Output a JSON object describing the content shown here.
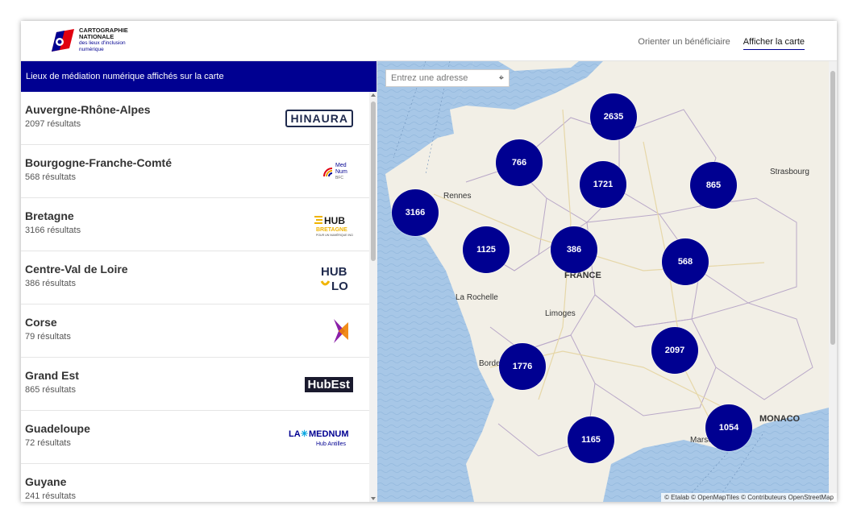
{
  "brand": {
    "line1": "CARTOGRAPHIE",
    "line2": "NATIONALE",
    "line3": "des lieux d'inclusion",
    "line4": "numérique"
  },
  "nav": {
    "orienter": "Orienter un bénéficiaire",
    "afficher": "Afficher la carte"
  },
  "sidebar": {
    "title": "Lieux de médiation numérique affichés sur la carte",
    "items": [
      {
        "name": "Auvergne-Rhône-Alpes",
        "count": "2097 résultats",
        "logo": "HINAURA"
      },
      {
        "name": "Bourgogne-Franche-Comté",
        "count": "568 résultats",
        "logo": "MedNum BFC"
      },
      {
        "name": "Bretagne",
        "count": "3166 résultats",
        "logo": "HUB BRETAGNE"
      },
      {
        "name": "Centre-Val de Loire",
        "count": "386 résultats",
        "logo": "HUB LO"
      },
      {
        "name": "Corse",
        "count": "79 résultats",
        "logo": "Corse"
      },
      {
        "name": "Grand Est",
        "count": "865 résultats",
        "logo": "HubEst"
      },
      {
        "name": "Guadeloupe",
        "count": "72 résultats",
        "logo": "LA MEDNUM Hub Antilles"
      },
      {
        "name": "Guyane",
        "count": "241 résultats",
        "logo": ""
      }
    ]
  },
  "map": {
    "search_placeholder": "Entrez une adresse",
    "clusters": [
      "2635",
      "766",
      "1721",
      "865",
      "3166",
      "1125",
      "386",
      "568",
      "1776",
      "2097",
      "1165",
      "1054"
    ],
    "labels": {
      "rennes": "Rennes",
      "france": "FRANCE",
      "larochelle": "La Rochelle",
      "limoges": "Limoges",
      "bordeaux": "Bordeaux",
      "strasbourg": "Strasbourg",
      "monaco": "MONACO",
      "marseille": "Marseille"
    },
    "attribution": "© Etalab © OpenMapTiles © Contributeurs OpenStreetMap"
  },
  "colors": {
    "primary": "#000091",
    "sea": "#a7c7e7",
    "land": "#f2efe6"
  }
}
